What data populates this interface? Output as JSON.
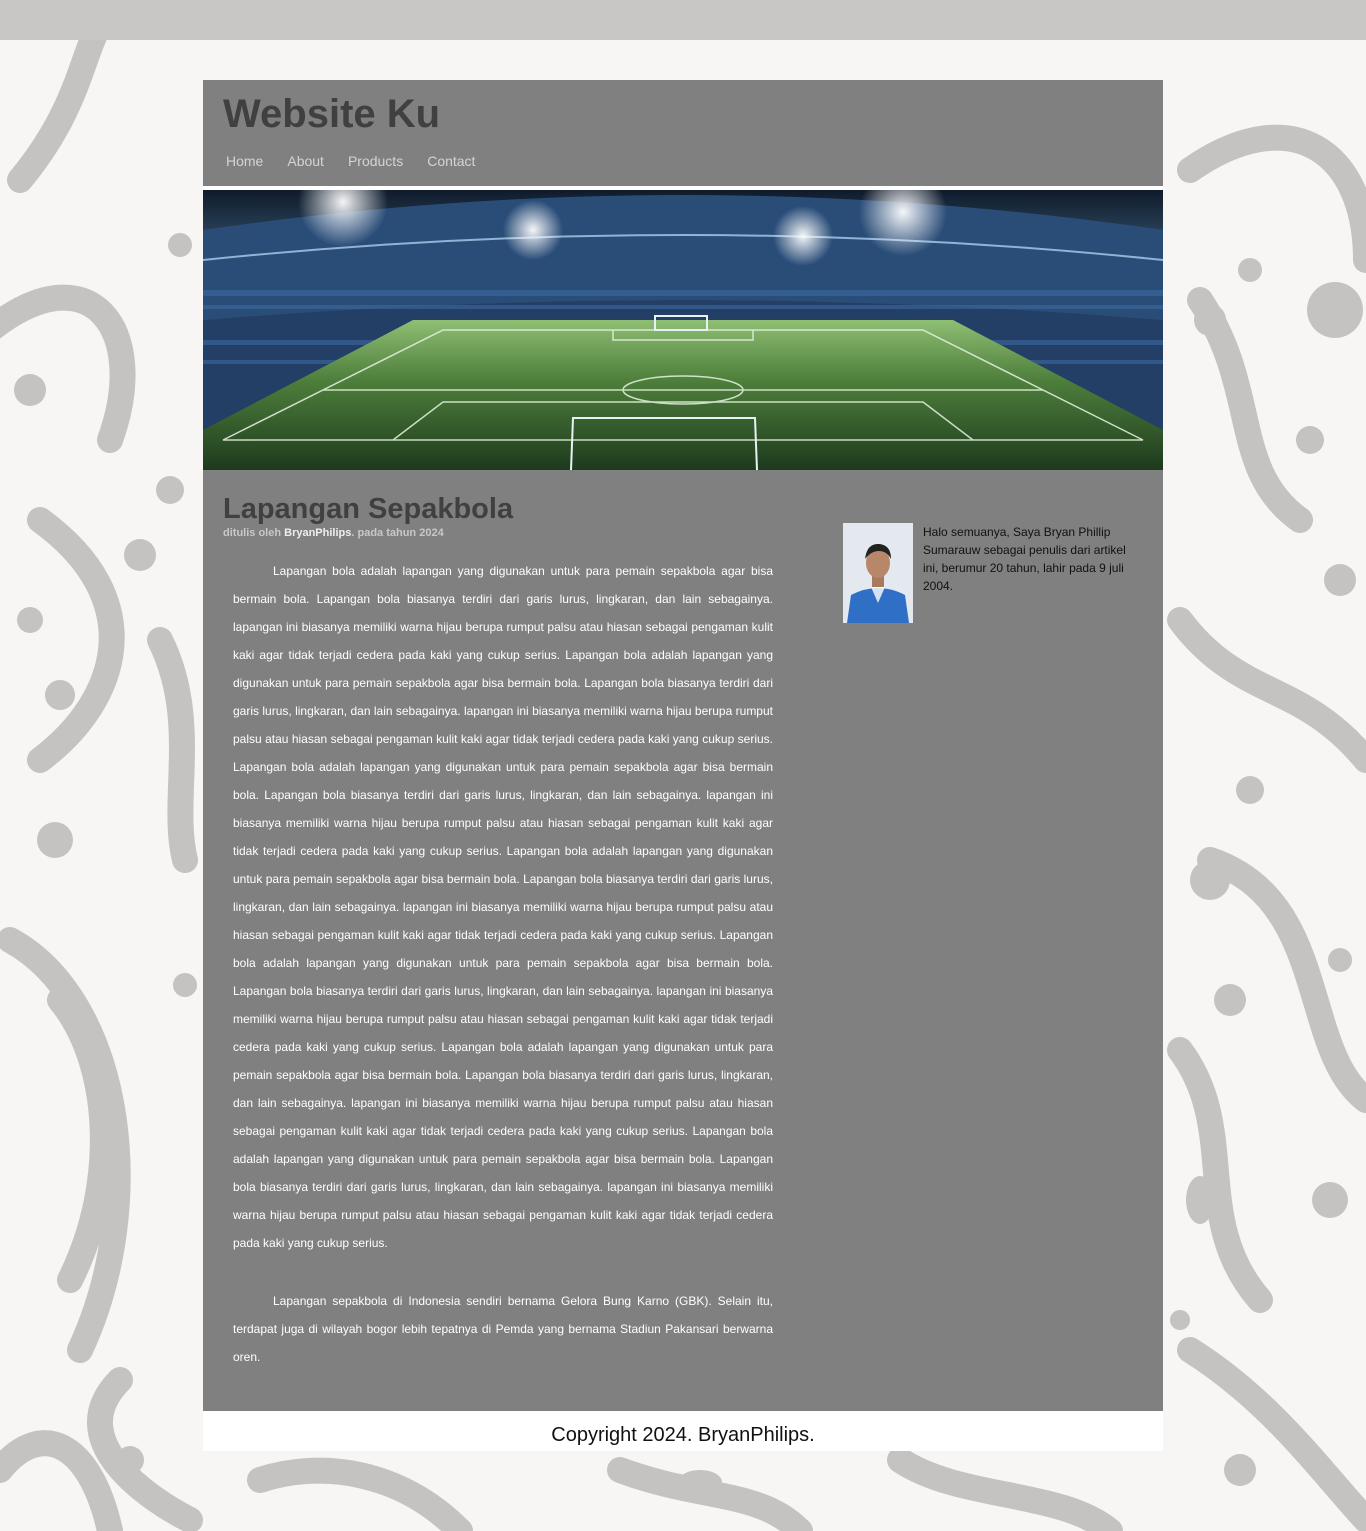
{
  "site": {
    "title": "Website Ku"
  },
  "nav": {
    "items": [
      "Home",
      "About",
      "Products",
      "Contact"
    ]
  },
  "article": {
    "title": "Lapangan Sepakbola",
    "meta_prefix": "ditulis oleh",
    "author": "BryanPhilips",
    "meta_suffix": ". pada tahun 2024",
    "paragraphs": [
      "Lapangan bola adalah lapangan yang digunakan untuk para pemain sepakbola agar bisa bermain bola. Lapangan bola biasanya terdiri dari garis lurus, lingkaran, dan lain sebagainya. lapangan ini biasanya memiliki warna hijau berupa rumput palsu atau hiasan sebagai pengaman kulit kaki agar tidak terjadi cedera pada kaki yang cukup serius. Lapangan bola adalah lapangan yang digunakan untuk para pemain sepakbola agar bisa bermain bola. Lapangan bola biasanya terdiri dari garis lurus, lingkaran, dan lain sebagainya. lapangan ini biasanya memiliki warna hijau berupa rumput palsu atau hiasan sebagai pengaman kulit kaki agar tidak terjadi cedera pada kaki yang cukup serius. Lapangan bola adalah lapangan yang digunakan untuk para pemain sepakbola agar bisa bermain bola. Lapangan bola biasanya terdiri dari garis lurus, lingkaran, dan lain sebagainya. lapangan ini biasanya memiliki warna hijau berupa rumput palsu atau hiasan sebagai pengaman kulit kaki agar tidak terjadi cedera pada kaki yang cukup serius. Lapangan bola adalah lapangan yang digunakan untuk para pemain sepakbola agar bisa bermain bola. Lapangan bola biasanya terdiri dari garis lurus, lingkaran, dan lain sebagainya. lapangan ini biasanya memiliki warna hijau berupa rumput palsu atau hiasan sebagai pengaman kulit kaki agar tidak terjadi cedera pada kaki yang cukup serius. Lapangan bola adalah lapangan yang digunakan untuk para pemain sepakbola agar bisa bermain bola. Lapangan bola biasanya terdiri dari garis lurus, lingkaran, dan lain sebagainya. lapangan ini biasanya memiliki warna hijau berupa rumput palsu atau hiasan sebagai pengaman kulit kaki agar tidak terjadi cedera pada kaki yang cukup serius. Lapangan bola adalah lapangan yang digunakan untuk para pemain sepakbola agar bisa bermain bola. Lapangan bola biasanya terdiri dari garis lurus, lingkaran, dan lain sebagainya. lapangan ini biasanya memiliki warna hijau berupa rumput palsu atau hiasan sebagai pengaman kulit kaki agar tidak terjadi cedera pada kaki yang cukup serius. Lapangan bola adalah lapangan yang digunakan untuk para pemain sepakbola agar bisa bermain bola. Lapangan bola biasanya terdiri dari garis lurus, lingkaran, dan lain sebagainya. lapangan ini biasanya memiliki warna hijau berupa rumput palsu atau hiasan sebagai pengaman kulit kaki agar tidak terjadi cedera pada kaki yang cukup serius.",
      "Lapangan sepakbola di Indonesia sendiri bernama Gelora Bung Karno (GBK). Selain itu, terdapat juga di wilayah bogor lebih tepatnya di Pemda yang bernama Stadiun Pakansari berwarna oren."
    ]
  },
  "sidebar": {
    "bio": "Halo semuanya, Saya Bryan Phillip Sumarauw sebagai penulis dari artikel ini, berumur 20 tahun, lahir pada 9 juli 2004."
  },
  "footer": {
    "text": "Copyright 2024. BryanPhilips."
  },
  "colors": {
    "page_bg": "#f7f6f4",
    "pattern": "#c4c3c1",
    "panel": "#808080",
    "title_text": "#404040",
    "footer_bg": "#ffffff"
  },
  "images": {
    "hero": "football-stadium-photo",
    "avatar": "author-photo"
  }
}
